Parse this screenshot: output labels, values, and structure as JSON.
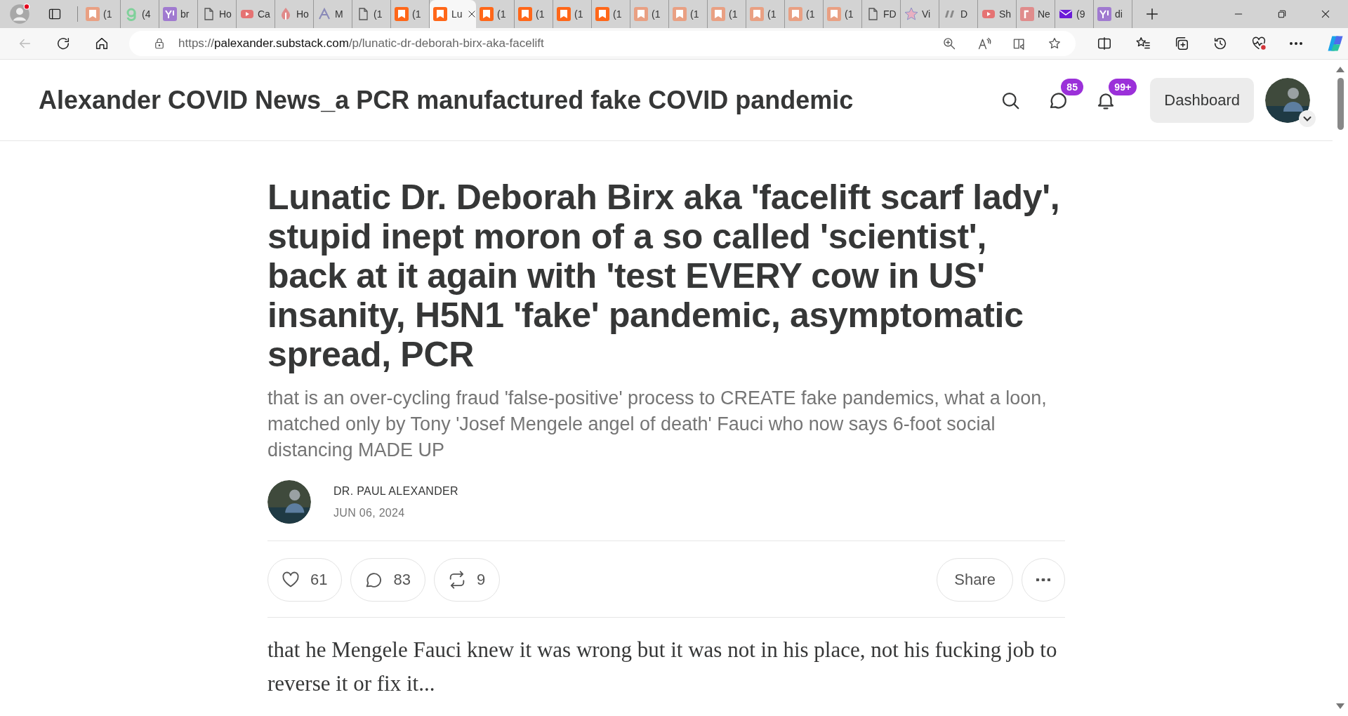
{
  "browser": {
    "tabs": [
      {
        "kind": "substack-dim",
        "label": "(1",
        "selected": false
      },
      {
        "kind": "g",
        "label": "(4",
        "selected": false
      },
      {
        "kind": "yahoo",
        "label": "br",
        "selected": false
      },
      {
        "kind": "doc",
        "label": "Ho",
        "selected": false
      },
      {
        "kind": "youtube",
        "label": "Ca",
        "selected": false
      },
      {
        "kind": "fire",
        "label": "Ho",
        "selected": false
      },
      {
        "kind": "a",
        "label": "M",
        "selected": false
      },
      {
        "kind": "doc",
        "label": "(1",
        "selected": false
      },
      {
        "kind": "substack",
        "label": "(1",
        "selected": false
      },
      {
        "kind": "substack",
        "label": "Lu",
        "selected": true
      },
      {
        "kind": "substack",
        "label": "(1",
        "selected": false
      },
      {
        "kind": "substack",
        "label": "(1",
        "selected": false
      },
      {
        "kind": "substack",
        "label": "(1",
        "selected": false
      },
      {
        "kind": "substack",
        "label": "(1",
        "selected": false
      },
      {
        "kind": "substack-dim",
        "label": "(1",
        "selected": false
      },
      {
        "kind": "substack-dim",
        "label": "(1",
        "selected": false
      },
      {
        "kind": "substack-dim",
        "label": "(1",
        "selected": false
      },
      {
        "kind": "substack-dim",
        "label": "(1",
        "selected": false
      },
      {
        "kind": "substack-dim",
        "label": "(1",
        "selected": false
      },
      {
        "kind": "substack-dim",
        "label": "(1",
        "selected": false
      },
      {
        "kind": "doc",
        "label": "FD",
        "selected": false
      },
      {
        "kind": "star",
        "label": "Vi",
        "selected": false
      },
      {
        "kind": "dr",
        "label": "D",
        "selected": false
      },
      {
        "kind": "youtube",
        "label": "Sh",
        "selected": false
      },
      {
        "kind": "r",
        "label": "Ne",
        "selected": false
      },
      {
        "kind": "mail",
        "label": "(9",
        "selected": false
      },
      {
        "kind": "yahoo",
        "label": "di",
        "selected": false
      }
    ],
    "address": {
      "scheme": "https://",
      "host": "palexander.substack.com",
      "path": "/p/lunatic-dr-deborah-birx-aka-facelift"
    }
  },
  "site_header": {
    "title": "Alexander COVID News_a PCR manufactured fake COVID pandemic",
    "chat_badge": "85",
    "notification_badge": "99+",
    "dashboard_button": "Dashboard"
  },
  "article": {
    "title": "Lunatic Dr. Deborah Birx aka 'facelift scarf lady', stupid inept moron of a so called 'scientist', back at it again with 'test EVERY cow in US' insanity, H5N1 'fake' pandemic, asymptomatic spread, PCR",
    "subtitle": "that is an over-cycling fraud 'false-positive' process to CREATE fake pandemics, what a loon, matched only by Tony 'Josef Mengele angel of death' Fauci who now says 6-foot social distancing MADE UP",
    "author": "DR. PAUL ALEXANDER",
    "date": "JUN 06, 2024",
    "reactions": [
      {
        "kind": "like",
        "count": "61"
      },
      {
        "kind": "comment",
        "count": "83"
      },
      {
        "kind": "restack",
        "count": "9"
      }
    ],
    "share_button": "Share",
    "body": "that he Mengele Fauci knew it was wrong but it was not in his place, not his fucking job to reverse it or fix it..."
  }
}
